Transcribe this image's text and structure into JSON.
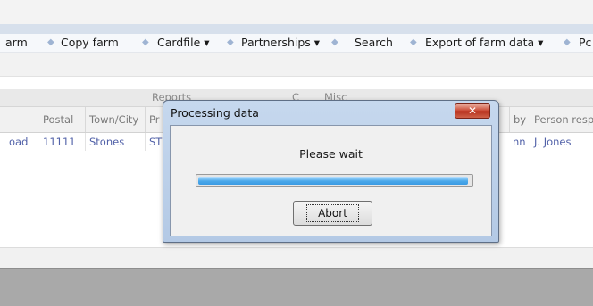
{
  "menubar": {
    "items": [
      "arm",
      "Copy farm",
      "Cardfile ▾",
      "Partnerships ▾",
      "Search",
      "Export of farm data ▾",
      "Pc"
    ]
  },
  "grid": {
    "groups": [
      "Reports",
      "C",
      "Misc"
    ],
    "columns": [
      "Postal",
      "Town/City",
      "Pr",
      "by",
      "Person resp"
    ],
    "row": {
      "address_fragment": "oad",
      "postal": "11111",
      "town": "Stones",
      "pr": "ST",
      "by": "nn",
      "person": "J. Jones"
    }
  },
  "dialog": {
    "title": "Processing data",
    "close_label": "✕",
    "message": "Please wait",
    "progress": 0.99,
    "abort_label": "Abort"
  },
  "colors": {
    "menu_bullet": "#9fb4d3",
    "link_text": "#5161a8",
    "dialog_frame": "#b9cde8",
    "close_button": "#c8442f",
    "progress_fill": "#3a9ae3"
  }
}
